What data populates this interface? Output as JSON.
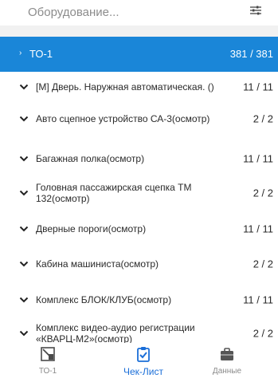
{
  "search": {
    "placeholder": "Оборудование..."
  },
  "filter": {
    "icon": "filter-sliders-icon"
  },
  "group": {
    "label": "ТО-1",
    "count": "381 / 381",
    "color": "#1a86d8"
  },
  "rows": [
    {
      "label": "[М]  Дверь. Наружная автоматическая. ()",
      "count": "11 / 11"
    },
    {
      "label": "Авто сцепное устройство СА-3(осмотр)",
      "count": "2 / 2"
    },
    {
      "label": "Багажная полка(осмотр)",
      "count": "11 / 11"
    },
    {
      "label": "Головная пассажирская сцепка ТМ 132(осмотр)",
      "count": "2 / 2"
    },
    {
      "label": "Дверные пороги(осмотр)",
      "count": "11 / 11"
    },
    {
      "label": "Кабина машиниста(осмотр)",
      "count": "2 / 2"
    },
    {
      "label": "Комплекс БЛОК/КЛУБ(осмотр)",
      "count": "11 / 11"
    },
    {
      "label": "Комплекс видео-аудио регистрации «КВАРЦ-М2»(осмотр)",
      "count": "2 / 2"
    }
  ],
  "nav": [
    {
      "label": "ТО-1",
      "icon": "pen-tool-icon"
    },
    {
      "label": "Чек-Лист",
      "icon": "clipboard-check-icon",
      "active": true
    },
    {
      "label": "Данные",
      "icon": "briefcase-icon"
    }
  ],
  "colors": {
    "accent": "#1a86d8",
    "active_nav": "#1a6ed8"
  }
}
